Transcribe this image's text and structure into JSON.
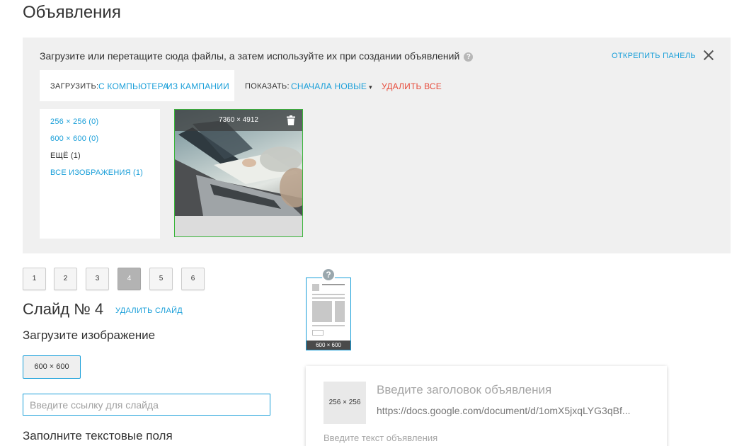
{
  "page": {
    "title": "Объявления"
  },
  "panel": {
    "description": "Загрузите или перетащите сюда файлы, а затем используйте их при создании объявлений",
    "help": "?",
    "unpin": "ОТКРЕПИТЬ ПАНЕЛЬ",
    "upload_label": "ЗАГРУЗИТЬ:",
    "from_computer": "С КОМПЬЮТЕРА",
    "from_campaign": "ИЗ КАМПАНИИ",
    "show_label": "ПОКАЗАТЬ:",
    "sort_value": "СНАЧАЛА НОВЫЕ",
    "caret": "▾",
    "delete_all": "УДАЛИТЬ ВСЕ",
    "filters": [
      "256 × 256 (0)",
      "600 × 600 (0)",
      "ЕЩЁ (1)",
      "ВСЕ ИЗОБРАЖЕНИЯ (1)"
    ],
    "image": {
      "dims": "7360 × 4912",
      "icon": "trash-icon"
    }
  },
  "slides": {
    "pages": [
      "1",
      "2",
      "3",
      "4",
      "5",
      "6"
    ],
    "active": "4",
    "title": "Слайд № 4",
    "delete": "УДАЛИТЬ СЛАЙД",
    "upload_heading": "Загрузите изображение",
    "size_button": "600 × 600",
    "link_placeholder": "Введите ссылку для слайда",
    "fill_heading": "Заполните текстовые поля"
  },
  "preview": {
    "help": "?",
    "mini_size": "600 × 600",
    "img_size": "256 × 256",
    "ad_title": "Введите заголовок объявления",
    "ad_url": "https://docs.google.com/document/d/1omX5jxqLYG3qBf...",
    "ad_text": "Введите текст объявления"
  },
  "colors": {
    "accent": "#1a9fd9",
    "danger": "#e74c3c",
    "selected_border": "#3ab53a",
    "panel_bg": "#f0f0f0"
  }
}
